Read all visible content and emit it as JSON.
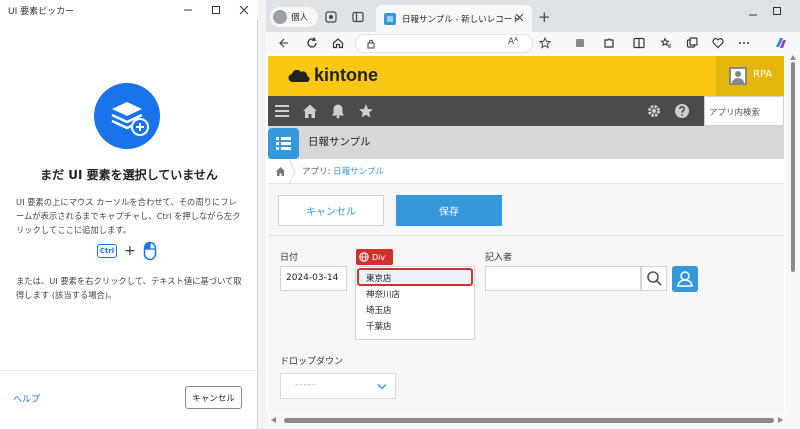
{
  "picker": {
    "title": "UI 要素ピッカー",
    "heading": "まだ UI 要素を選択していません",
    "description": "UI 要素の上にマウス カーソルを合わせて、その周りにフレームが表示されるまでキャプチャし、Ctrl を押しながら左クリックしてここに追加します。",
    "ctrl_key_label": "Ctrl",
    "plus": "+",
    "alt_description": "または、UI 要素を右クリックして、テキスト値に基づいて取得します (該当する場合)。",
    "help_label": "ヘルプ",
    "cancel_label": "キャンセル",
    "accent_color": "#1a73e8"
  },
  "browser": {
    "profile_label": "個人",
    "tab_title": "日報サンプル - 新しいレコード",
    "new_tab": "+",
    "toolbar_text": "Aᴬ"
  },
  "kintone": {
    "logo_text": "kintone",
    "user_label": "RPA",
    "search_placeholder": "アプリ内検索",
    "app_title": "日報サンプル",
    "breadcrumb_prefix": "アプリ: ",
    "breadcrumb_link": "日報サンプル",
    "cancel_label": "キャンセル",
    "save_label": "保存",
    "date_label": "日付",
    "date_value": "2024-03-14",
    "badge_label": "Div",
    "stores": [
      "東京店",
      "神奈川店",
      "埼玉店",
      "千葉店"
    ],
    "selected_store": "東京店",
    "author_label": "記入者",
    "dropdown_label": "ドロップダウン",
    "dropdown_value": "-----",
    "brand_color": "#fac712",
    "primary_color": "#3498db",
    "highlight_color": "#d0312d"
  }
}
